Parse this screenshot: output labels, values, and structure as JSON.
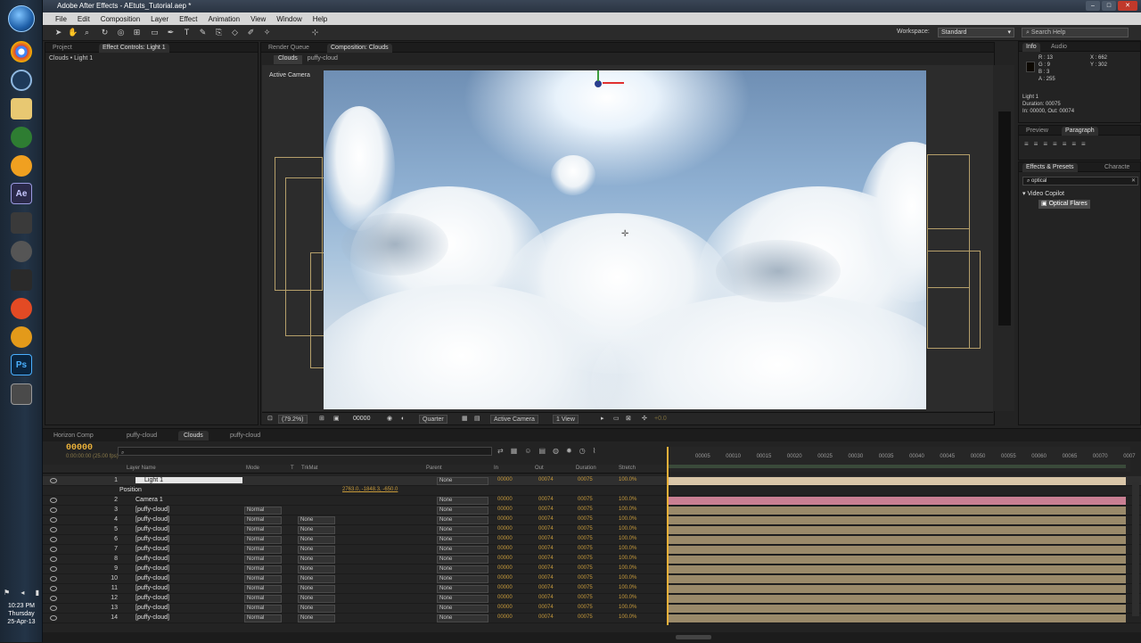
{
  "os": {
    "taskbar_icons": [
      "chrome-icon",
      "settings-icon",
      "folder-icon",
      "leaf-icon",
      "camtasia-icon",
      "after-effects-icon",
      "game-icon",
      "skull-icon",
      "rocket-icon",
      "record-icon",
      "audition-icon",
      "photoshop-icon",
      "capture-icon"
    ],
    "clock_time": "10:23 PM",
    "clock_day": "Thursday",
    "clock_date": "25-Apr-13"
  },
  "app": {
    "title": "Adobe After Effects - AEtuts_Tutorial.aep *",
    "menus": [
      "File",
      "Edit",
      "Composition",
      "Layer",
      "Effect",
      "Animation",
      "View",
      "Window",
      "Help"
    ],
    "workspace_label": "Workspace:",
    "workspace_value": "Standard",
    "search_help": "Search Help"
  },
  "project_panel": {
    "tabs": [
      "Project",
      "Effect Controls: Light 1"
    ],
    "breadcrumb": "Clouds • Light 1"
  },
  "viewer": {
    "tabs": [
      "Render Queue",
      "Composition: Clouds"
    ],
    "breadcrumbs": [
      "Clouds",
      "puffy-cloud"
    ],
    "active_camera_label": "Active Camera",
    "footer": {
      "zoom": "(79.2%)",
      "timecode": "00000",
      "resolution": "Quarter",
      "view": "Active Camera",
      "views_count": "1 View",
      "exposure": "+0.0"
    }
  },
  "info_panel": {
    "tabs": [
      "Info",
      "Audio"
    ],
    "r": "R : 13",
    "g": "G : 9",
    "b": "B : 3",
    "a": "A : 255",
    "x": "X : 662",
    "y": "Y : 302",
    "layer_name": "Light 1",
    "duration": "Duration: 00075",
    "in_out": "In: 00000, Out: 00074"
  },
  "paragraph_panel": {
    "tabs": [
      "Preview",
      "Paragraph"
    ]
  },
  "effects_panel": {
    "tabs": [
      "Effects & Presets",
      "Characte"
    ],
    "search_value": "optical",
    "category": "Video Copilot",
    "item": "Optical Flares"
  },
  "timeline": {
    "tabs": [
      "Horizon Comp",
      "puffy-cloud",
      "Clouds",
      "puffy-cloud"
    ],
    "active_tab": 2,
    "timecode": "00000",
    "timecode_sub": "0:00:00:00 (25.00 fps)",
    "column_headers": [
      "Layer Name",
      "Mode",
      "T",
      "TrkMat",
      "Parent",
      "In",
      "Out",
      "Duration",
      "Stretch"
    ],
    "ruler_ticks": [
      "00005",
      "00010",
      "00015",
      "00020",
      "00025",
      "00030",
      "00035",
      "00040",
      "00045",
      "00050",
      "00055",
      "00060",
      "00065",
      "00070",
      "0007"
    ],
    "position_label": "Position",
    "position_value": "2763.0, -1848.3, -650.0",
    "layers": [
      {
        "num": "1",
        "name": "Light 1",
        "mode": "",
        "trkmat": "",
        "parent": "None",
        "in": "00000",
        "out": "00074",
        "dur": "00075",
        "stretch": "100.0%"
      },
      {
        "num": "2",
        "name": "Camera 1",
        "mode": "",
        "trkmat": "",
        "parent": "None",
        "in": "00000",
        "out": "00074",
        "dur": "00075",
        "stretch": "100.0%"
      },
      {
        "num": "3",
        "name": "[puffy-cloud]",
        "mode": "Normal",
        "trkmat": "",
        "parent": "None",
        "in": "00000",
        "out": "00074",
        "dur": "00075",
        "stretch": "100.0%"
      },
      {
        "num": "4",
        "name": "[puffy-cloud]",
        "mode": "Normal",
        "trkmat": "None",
        "parent": "None",
        "in": "00000",
        "out": "00074",
        "dur": "00075",
        "stretch": "100.0%"
      },
      {
        "num": "5",
        "name": "[puffy-cloud]",
        "mode": "Normal",
        "trkmat": "None",
        "parent": "None",
        "in": "00000",
        "out": "00074",
        "dur": "00075",
        "stretch": "100.0%"
      },
      {
        "num": "6",
        "name": "[puffy-cloud]",
        "mode": "Normal",
        "trkmat": "None",
        "parent": "None",
        "in": "00000",
        "out": "00074",
        "dur": "00075",
        "stretch": "100.0%"
      },
      {
        "num": "7",
        "name": "[puffy-cloud]",
        "mode": "Normal",
        "trkmat": "None",
        "parent": "None",
        "in": "00000",
        "out": "00074",
        "dur": "00075",
        "stretch": "100.0%"
      },
      {
        "num": "8",
        "name": "[puffy-cloud]",
        "mode": "Normal",
        "trkmat": "None",
        "parent": "None",
        "in": "00000",
        "out": "00074",
        "dur": "00075",
        "stretch": "100.0%"
      },
      {
        "num": "9",
        "name": "[puffy-cloud]",
        "mode": "Normal",
        "trkmat": "None",
        "parent": "None",
        "in": "00000",
        "out": "00074",
        "dur": "00075",
        "stretch": "100.0%"
      },
      {
        "num": "10",
        "name": "[puffy-cloud]",
        "mode": "Normal",
        "trkmat": "None",
        "parent": "None",
        "in": "00000",
        "out": "00074",
        "dur": "00075",
        "stretch": "100.0%"
      },
      {
        "num": "11",
        "name": "[puffy-cloud]",
        "mode": "Normal",
        "trkmat": "None",
        "parent": "None",
        "in": "00000",
        "out": "00074",
        "dur": "00075",
        "stretch": "100.0%"
      },
      {
        "num": "12",
        "name": "[puffy-cloud]",
        "mode": "Normal",
        "trkmat": "None",
        "parent": "None",
        "in": "00000",
        "out": "00074",
        "dur": "00075",
        "stretch": "100.0%"
      },
      {
        "num": "13",
        "name": "[puffy-cloud]",
        "mode": "Normal",
        "trkmat": "None",
        "parent": "None",
        "in": "00000",
        "out": "00074",
        "dur": "00075",
        "stretch": "100.0%"
      },
      {
        "num": "14",
        "name": "[puffy-cloud]",
        "mode": "Normal",
        "trkmat": "None",
        "parent": "None",
        "in": "00000",
        "out": "00074",
        "dur": "00075",
        "stretch": "100.0%"
      }
    ]
  },
  "colors": {
    "accent_timecode": "#e9b03a",
    "light_bar": "#d9c6a8",
    "camera_bar": "#c97f93",
    "cloud_bar": "#9a8a6a"
  }
}
